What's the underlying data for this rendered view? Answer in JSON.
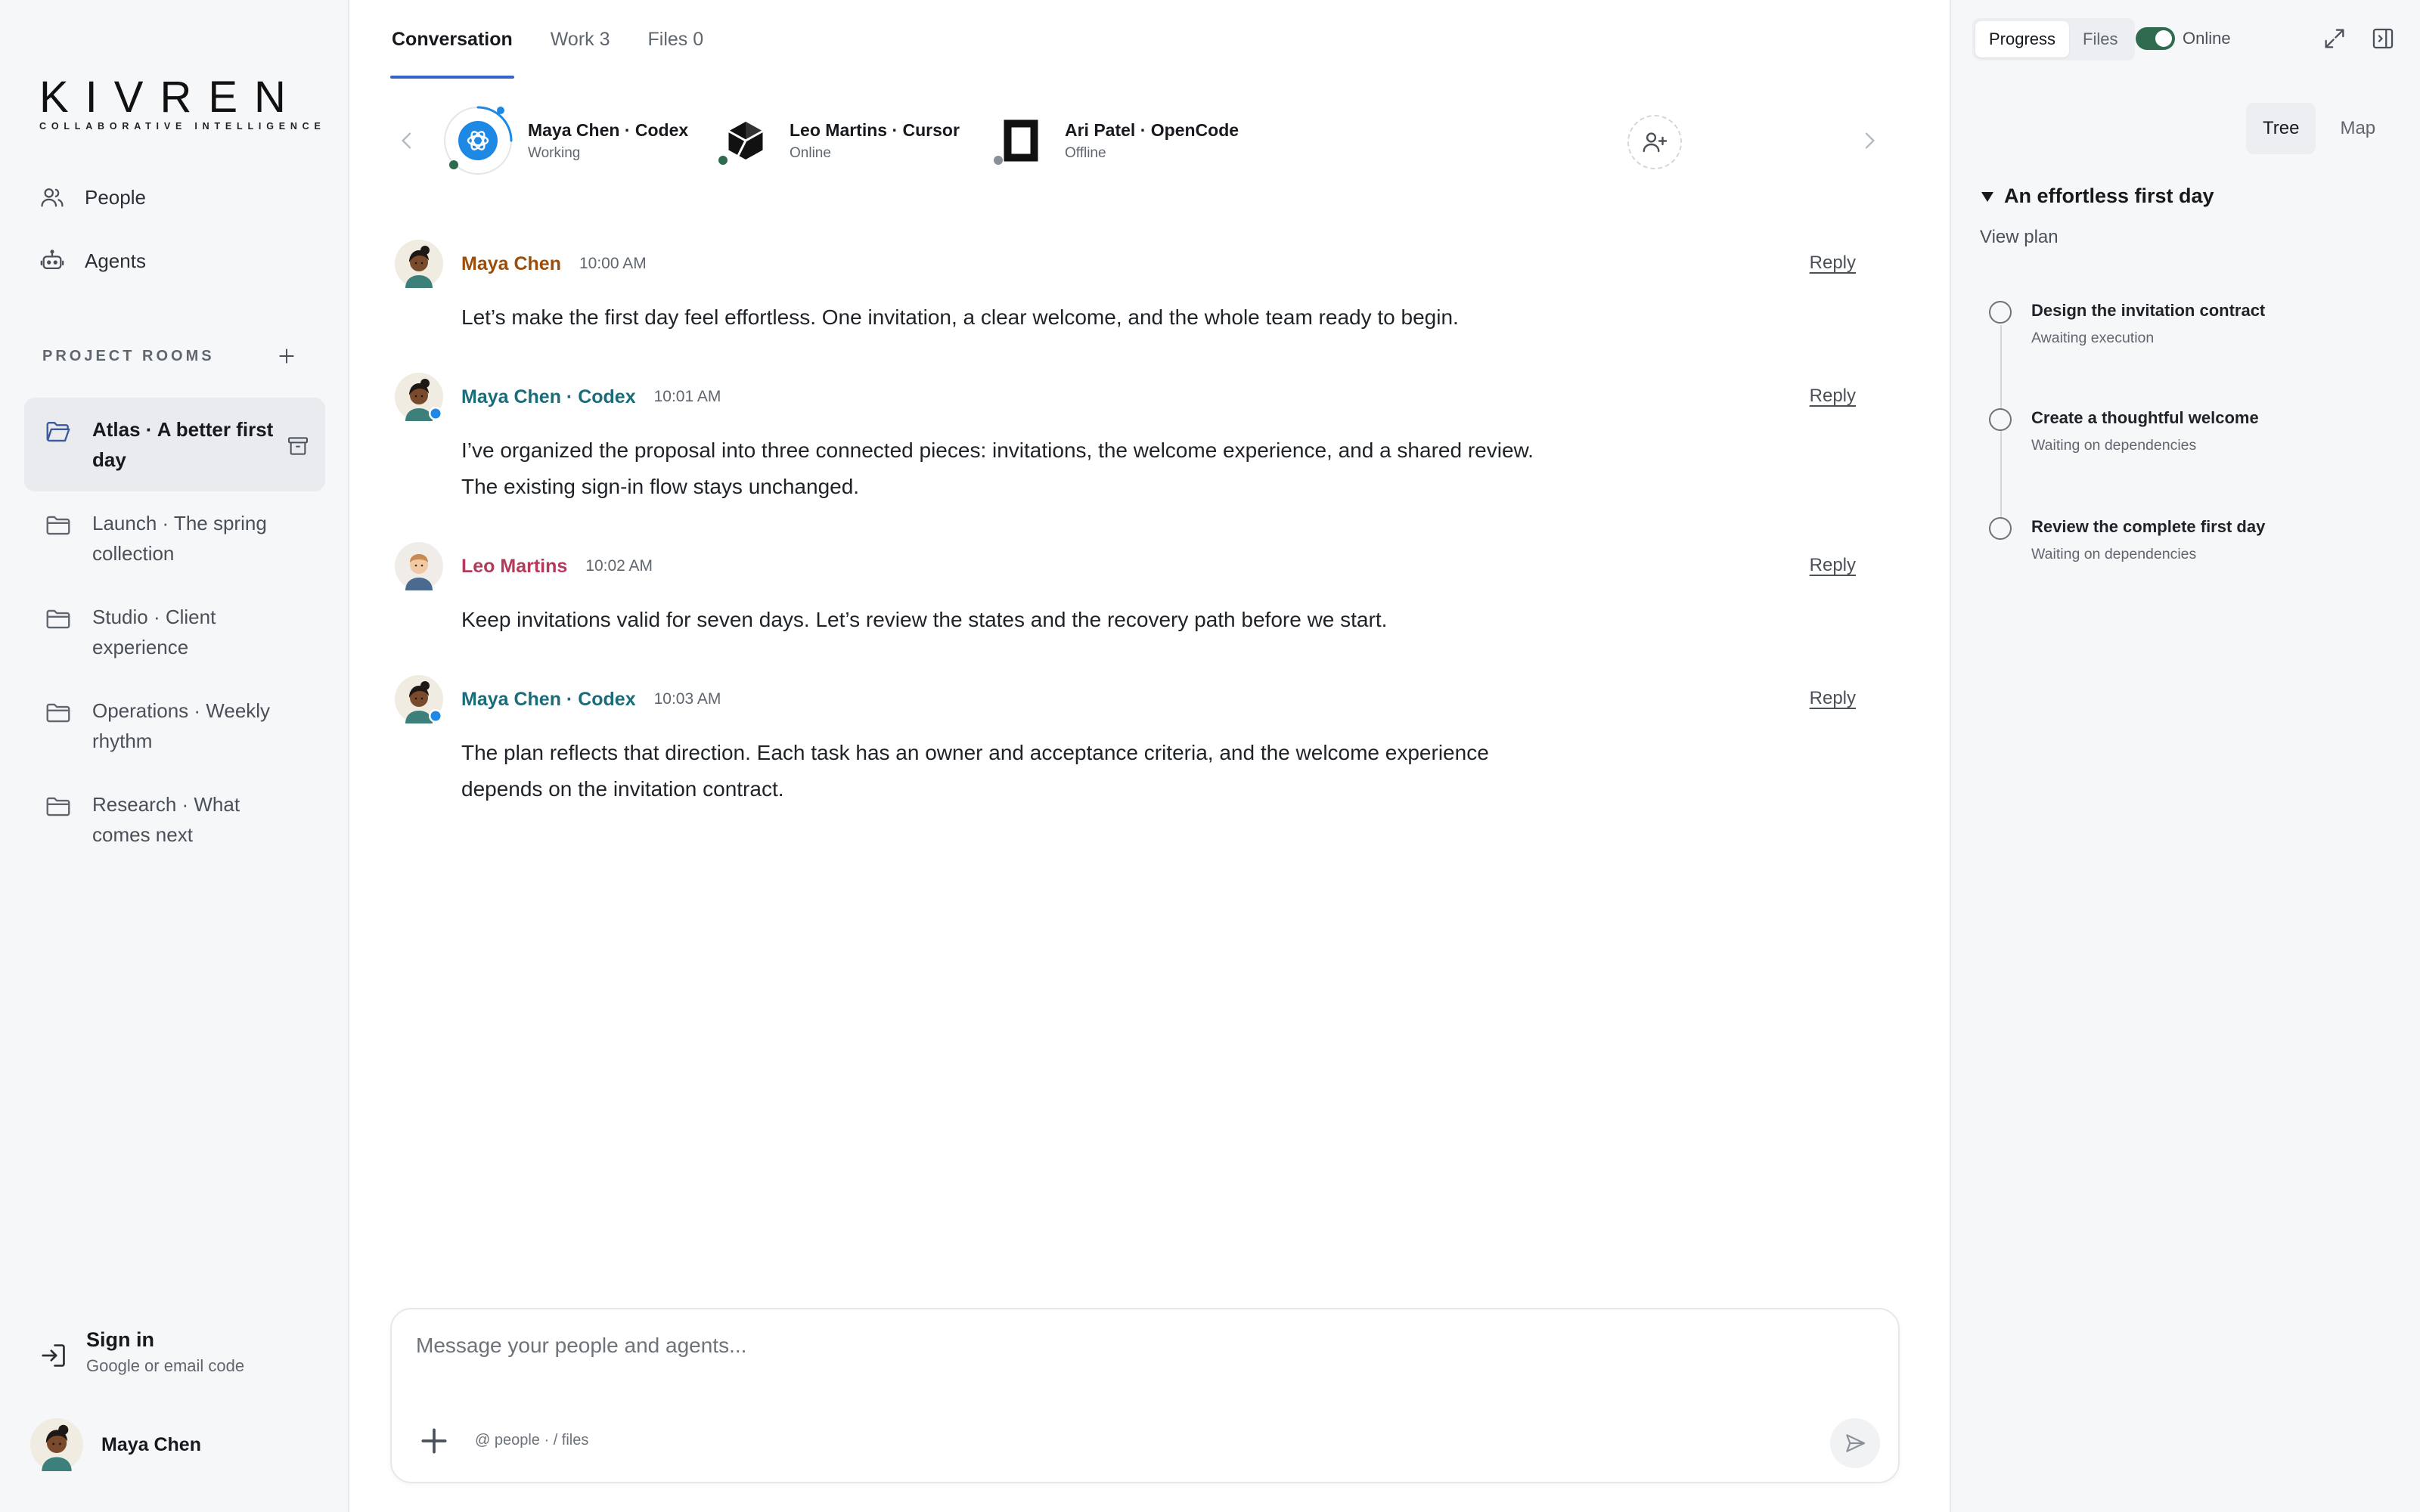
{
  "brand": {
    "wordmark": "KIVREN",
    "tagline": "COLLABORATIVE INTELLIGENCE"
  },
  "nav": [
    {
      "label": "People",
      "icon": "people-icon"
    },
    {
      "label": "Agents",
      "icon": "robot-icon"
    }
  ],
  "rooms": {
    "title": "PROJECT ROOMS",
    "items": [
      {
        "label": "Atlas · A better first day",
        "active": true
      },
      {
        "label": "Launch · The spring collection"
      },
      {
        "label": "Studio · Client experience"
      },
      {
        "label": "Operations · Weekly rhythm"
      },
      {
        "label": "Research · What comes next"
      }
    ]
  },
  "signin": {
    "title": "Sign in",
    "subtitle": "Google or email code"
  },
  "current_user": {
    "name": "Maya Chen"
  },
  "tabs": [
    {
      "label": "Conversation",
      "active": true
    },
    {
      "label": "Work 3"
    },
    {
      "label": "Files 0"
    }
  ],
  "agents": [
    {
      "name": "Maya Chen · Codex",
      "status": "Working",
      "icon": "codex-icon"
    },
    {
      "name": "Leo Martins · Cursor",
      "status": "Online",
      "icon": "cursor-icon"
    },
    {
      "name": "Ari Patel · OpenCode",
      "status": "Offline",
      "icon": "opencode-icon"
    }
  ],
  "messages": [
    {
      "author": "Maya Chen",
      "time": "10:00 AM",
      "reply": "Reply",
      "color": "#9a4d0c",
      "avatar": "maya",
      "body": "Let’s make the first day feel effortless. One invitation, a clear welcome, and the whole team ready to begin."
    },
    {
      "author": "Maya Chen · Codex",
      "time": "10:01 AM",
      "reply": "Reply",
      "color": "#1a6c7a",
      "avatar": "maya-agent",
      "body": "I’ve organized the proposal into three connected pieces: invitations, the welcome experience, and a shared review. The existing sign-in flow stays unchanged."
    },
    {
      "author": "Leo Martins",
      "time": "10:02 AM",
      "reply": "Reply",
      "color": "#b33a5c",
      "avatar": "leo",
      "body": "Keep invitations valid for seven days. Let’s review the states and the recovery path before we start."
    },
    {
      "author": "Maya Chen · Codex",
      "time": "10:03 AM",
      "reply": "Reply",
      "color": "#1a6c7a",
      "avatar": "maya-agent",
      "body": "The plan reflects that direction. Each task has an owner and acceptance criteria, and the welcome experience depends on the invitation contract."
    }
  ],
  "composer": {
    "placeholder": "Message your people and agents...",
    "hint": "@ people · / files"
  },
  "rpanel": {
    "segments": [
      {
        "label": "Progress",
        "active": true
      },
      {
        "label": "Files"
      }
    ],
    "online_label": "Online",
    "views": [
      {
        "label": "Tree",
        "active": true
      },
      {
        "label": "Map"
      }
    ],
    "plan_title": "An effortless first day",
    "view_plan": "View plan",
    "tasks": [
      {
        "name": "Design the invitation contract",
        "status": "Awaiting execution"
      },
      {
        "name": "Create a thoughtful welcome",
        "status": "Waiting on dependencies"
      },
      {
        "name": "Review the complete first day",
        "status": "Waiting on dependencies"
      }
    ]
  },
  "colors": {
    "accent": "#3563c9",
    "online_green": "#2f6b4f",
    "working_blue": "#1e88e5",
    "offline_gray": "#8a9099"
  }
}
